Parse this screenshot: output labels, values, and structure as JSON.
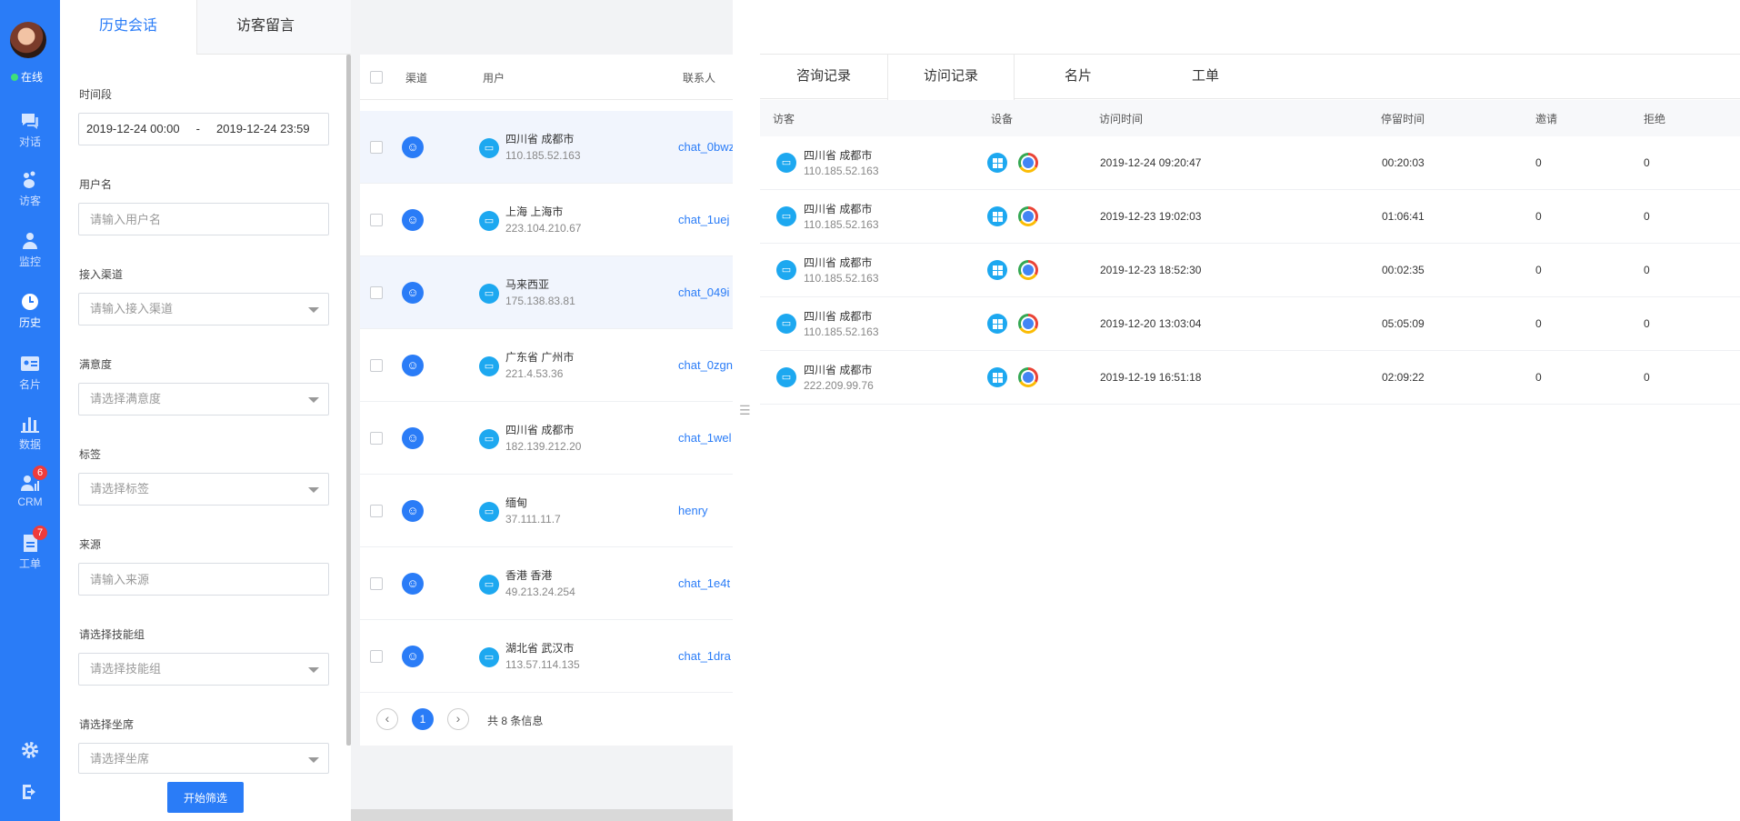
{
  "sidebar": {
    "status": "在线",
    "items": [
      {
        "label": "对话",
        "icon": "chat-icon"
      },
      {
        "label": "访客",
        "icon": "visitor-icon"
      },
      {
        "label": "监控",
        "icon": "monitor-icon"
      },
      {
        "label": "历史",
        "icon": "history-icon"
      },
      {
        "label": "名片",
        "icon": "card-icon"
      },
      {
        "label": "数据",
        "icon": "chart-icon"
      },
      {
        "label": "CRM",
        "icon": "crm-icon",
        "badge": "6"
      },
      {
        "label": "工单",
        "icon": "ticket-icon",
        "badge": "7"
      }
    ],
    "bottom": [
      "gear-icon",
      "logout-icon"
    ]
  },
  "filter": {
    "tabs": [
      "历史会话",
      "访客留言"
    ],
    "date_label": "时间段",
    "date_start": "2019-12-24 00:00",
    "date_sep": "-",
    "date_end": "2019-12-24 23:59",
    "username_label": "用户名",
    "username_placeholder": "请输入用户名",
    "channel_label": "接入渠道",
    "channel_placeholder": "请输入接入渠道",
    "satisfaction_label": "满意度",
    "satisfaction_placeholder": "请选择满意度",
    "tag_label": "标签",
    "tag_placeholder": "请选择标签",
    "source_label": "来源",
    "source_placeholder": "请输入来源",
    "skill_label": "请选择技能组",
    "skill_placeholder": "请选择技能组",
    "seat_label": "请选择坐席",
    "seat_placeholder": "请选择坐席",
    "submit": "开始筛选"
  },
  "sessions": {
    "headers": {
      "channel": "渠道",
      "user": "用户",
      "contact": "联系人"
    },
    "rows": [
      {
        "loc": "四川省 成都市",
        "ip": "110.185.52.163",
        "contact": "chat_0bwz"
      },
      {
        "loc": "上海 上海市",
        "ip": "223.104.210.67",
        "contact": "chat_1uej"
      },
      {
        "loc": "马来西亚",
        "ip": "175.138.83.81",
        "contact": "chat_049i"
      },
      {
        "loc": "广东省 广州市",
        "ip": "221.4.53.36",
        "contact": "chat_0zgn"
      },
      {
        "loc": "四川省 成都市",
        "ip": "182.139.212.20",
        "contact": "chat_1wel"
      },
      {
        "loc": "缅甸",
        "ip": "37.111.11.7",
        "contact": "henry"
      },
      {
        "loc": "香港 香港",
        "ip": "49.213.24.254",
        "contact": "chat_1e4t"
      },
      {
        "loc": "湖北省 武汉市",
        "ip": "113.57.114.135",
        "contact": "chat_1dra"
      }
    ],
    "pager": {
      "prev": "‹",
      "current": "1",
      "next": "›",
      "total": "共 8 条信息"
    }
  },
  "detail": {
    "tabs": [
      "咨询记录",
      "访问记录",
      "名片",
      "工单"
    ],
    "headers": {
      "visitor": "访客",
      "device": "设备",
      "time": "访问时间",
      "stay": "停留时间",
      "invite": "邀请",
      "reject": "拒绝"
    },
    "rows": [
      {
        "loc": "四川省 成都市",
        "ip": "110.185.52.163",
        "time": "2019-12-24 09:20:47",
        "stay": "00:20:03",
        "invite": "0",
        "reject": "0"
      },
      {
        "loc": "四川省 成都市",
        "ip": "110.185.52.163",
        "time": "2019-12-23 19:02:03",
        "stay": "01:06:41",
        "invite": "0",
        "reject": "0"
      },
      {
        "loc": "四川省 成都市",
        "ip": "110.185.52.163",
        "time": "2019-12-23 18:52:30",
        "stay": "00:02:35",
        "invite": "0",
        "reject": "0"
      },
      {
        "loc": "四川省 成都市",
        "ip": "110.185.52.163",
        "time": "2019-12-20 13:03:04",
        "stay": "05:05:09",
        "invite": "0",
        "reject": "0"
      },
      {
        "loc": "四川省 成都市",
        "ip": "222.209.99.76",
        "time": "2019-12-19 16:51:18",
        "stay": "02:09:22",
        "invite": "0",
        "reject": "0"
      }
    ]
  },
  "colors": {
    "primary": "#2a7cf7",
    "device": "#1da8f0",
    "badge": "#ef3b3b",
    "online": "#3ee07a"
  }
}
